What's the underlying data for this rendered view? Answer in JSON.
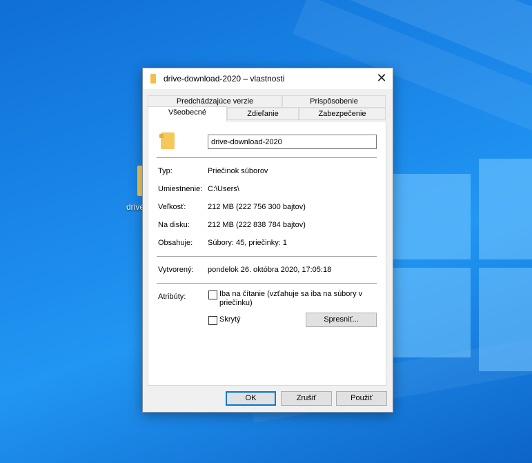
{
  "desktop": {
    "icon_label": "drive"
  },
  "dialog": {
    "title": "drive-download-2020 – vlastnosti",
    "close_glyph": "✕",
    "tabs": {
      "previous_versions": "Predchádzajúce verzie",
      "customize": "Prispôsobenie",
      "general": "Všeobecné",
      "sharing": "Zdieľanie",
      "security": "Zabezpečenie"
    },
    "general": {
      "folder_name": "drive-download-2020",
      "type_label": "Typ:",
      "type_value": "Priečinok súborov",
      "location_label": "Umiestnenie:",
      "location_value": "C:\\Users\\",
      "size_label": "Veľkosť:",
      "size_value": "212 MB (222 756 300 bajtov)",
      "disk_label": "Na disku:",
      "disk_value": "212 MB (222 838 784 bajtov)",
      "contains_label": "Obsahuje:",
      "contains_value": "Súbory: 45, priečinky: 1",
      "created_label": "Vytvorený:",
      "created_value": "pondelok 26. októbra 2020, 17:05:18",
      "attributes_label": "Atribúty:",
      "readonly_line1": "Iba na čítanie (vzťahuje sa iba na súbory v",
      "readonly_line2": "priečinku)",
      "hidden_label": "Skrytý",
      "advanced_button": "Spresniť..."
    },
    "buttons": {
      "ok": "OK",
      "cancel": "Zrušiť",
      "apply": "Použiť"
    }
  },
  "colors": {
    "desktop_blue": "#1a86e8",
    "accent": "#0078d7",
    "folder_yellow": "#f4c85a"
  }
}
